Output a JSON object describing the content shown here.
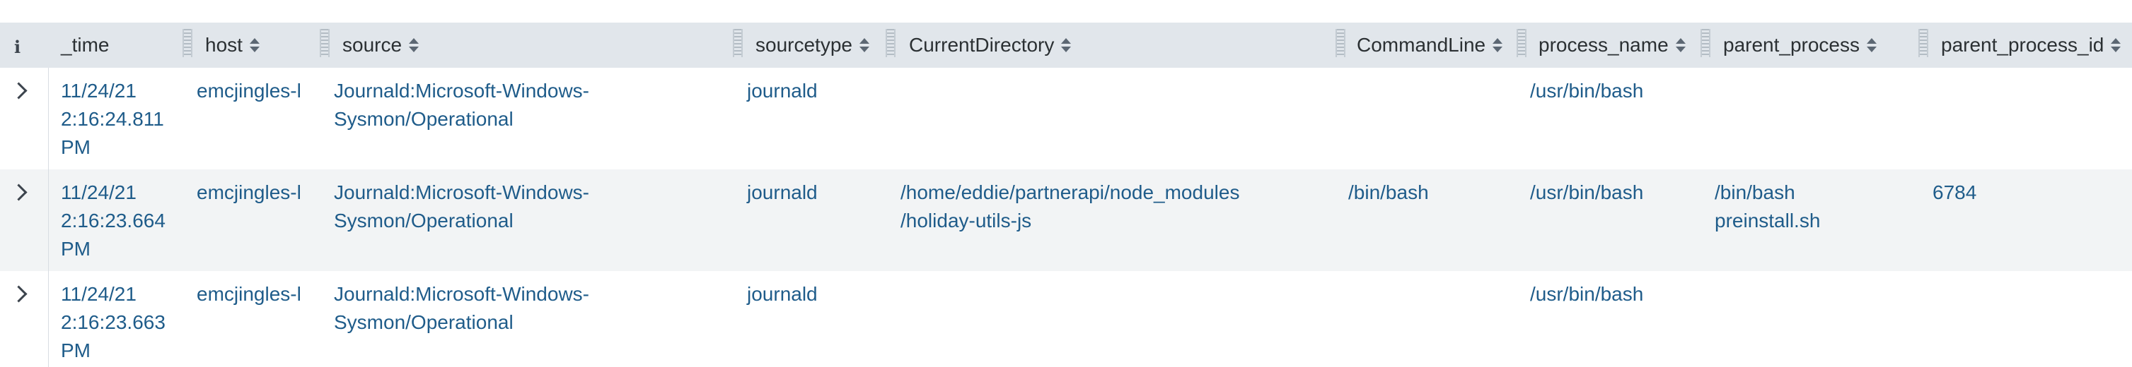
{
  "header": {
    "info_icon": "i",
    "columns": [
      {
        "label": "_time"
      },
      {
        "label": "host"
      },
      {
        "label": "source"
      },
      {
        "label": "sourcetype"
      },
      {
        "label": "CurrentDirectory"
      },
      {
        "label": "CommandLine"
      },
      {
        "label": "process_name"
      },
      {
        "label": "parent_process"
      },
      {
        "label": "parent_process_id"
      }
    ]
  },
  "rows": [
    {
      "time_date": "11/24/21",
      "time_clock": "2:16:24.811",
      "time_ampm": "PM",
      "host": "emcjingles-l",
      "source_line1": "Journald:Microsoft-Windows-",
      "source_line2": "Sysmon/Operational",
      "sourcetype": "journald",
      "current_dir_line1": "",
      "current_dir_line2": "",
      "command_line": "",
      "process_name": "/usr/bin/bash",
      "parent_process_line1": "",
      "parent_process_line2": "",
      "parent_process_id": ""
    },
    {
      "time_date": "11/24/21",
      "time_clock": "2:16:23.664",
      "time_ampm": "PM",
      "host": "emcjingles-l",
      "source_line1": "Journald:Microsoft-Windows-",
      "source_line2": "Sysmon/Operational",
      "sourcetype": "journald",
      "current_dir_line1": "/home/eddie/partnerapi/node_modules",
      "current_dir_line2": "/holiday-utils-js",
      "command_line": "/bin/bash",
      "process_name": "/usr/bin/bash",
      "parent_process_line1": "/bin/bash",
      "parent_process_line2": "preinstall.sh",
      "parent_process_id": "6784"
    },
    {
      "time_date": "11/24/21",
      "time_clock": "2:16:23.663",
      "time_ampm": "PM",
      "host": "emcjingles-l",
      "source_line1": "Journald:Microsoft-Windows-",
      "source_line2": "Sysmon/Operational",
      "sourcetype": "journald",
      "current_dir_line1": "",
      "current_dir_line2": "",
      "command_line": "",
      "process_name": "/usr/bin/bash",
      "parent_process_line1": "",
      "parent_process_line2": "",
      "parent_process_id": ""
    }
  ]
}
